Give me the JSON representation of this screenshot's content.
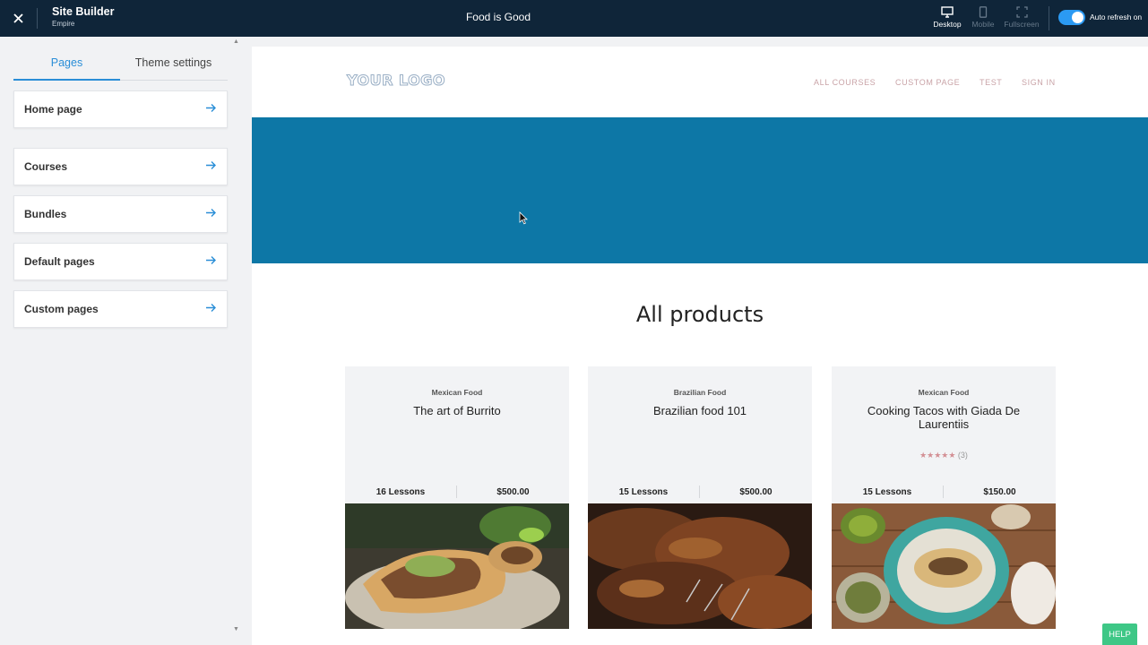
{
  "topbar": {
    "app_title": "Site Builder",
    "app_subtitle": "Empire",
    "site_title": "Food is Good",
    "views": [
      {
        "label": "Desktop",
        "icon": "desktop-icon",
        "active": true
      },
      {
        "label": "Mobile",
        "icon": "mobile-icon",
        "active": false
      },
      {
        "label": "Fullscreen",
        "icon": "fullscreen-icon",
        "active": false
      }
    ],
    "auto_refresh": {
      "label": "Auto refresh on",
      "on": true
    },
    "colors": {
      "bar": "#0f2539",
      "toggle": "#2b9af3"
    }
  },
  "sidebar": {
    "tabs": [
      {
        "label": "Pages",
        "active": true
      },
      {
        "label": "Theme settings",
        "active": false
      }
    ],
    "items": [
      {
        "label": "Home page"
      },
      {
        "label": "Courses"
      },
      {
        "label": "Bundles"
      },
      {
        "label": "Default pages"
      },
      {
        "label": "Custom pages"
      }
    ],
    "accent": "#2a8ed7"
  },
  "preview": {
    "logo": "YOUR LOGO",
    "nav": [
      "ALL COURSES",
      "CUSTOM PAGE",
      "TEST",
      "SIGN IN"
    ],
    "hero_color": "#0d77a6",
    "heading": "All products",
    "products": [
      {
        "category": "Mexican Food",
        "title": "The art of Burrito",
        "rating_stars": "",
        "rating_count": "",
        "lessons": "16 Lessons",
        "price": "$500.00",
        "image": "burrito-photo"
      },
      {
        "category": "Brazilian Food",
        "title": "Brazilian food 101",
        "rating_stars": "",
        "rating_count": "",
        "lessons": "15 Lessons",
        "price": "$500.00",
        "image": "grilled-meat-photo"
      },
      {
        "category": "Mexican Food",
        "title": "Cooking Tacos with Giada De Laurentiis",
        "rating_stars": "★★★★★",
        "rating_count": "(3)",
        "lessons": "15 Lessons",
        "price": "$150.00",
        "image": "tacos-photo"
      }
    ]
  },
  "help": {
    "label": "HELP",
    "color": "#3ec786"
  }
}
